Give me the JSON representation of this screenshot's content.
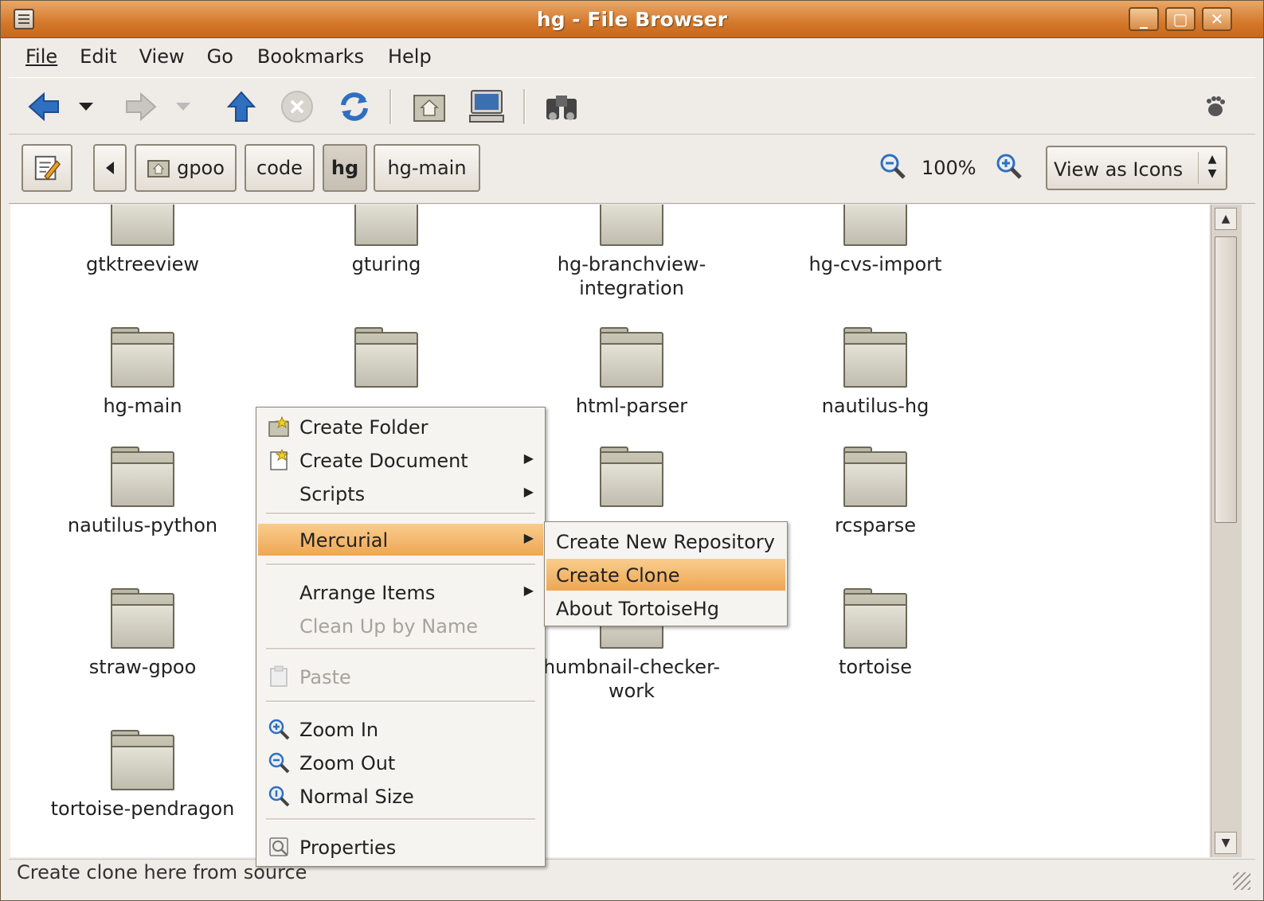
{
  "window": {
    "title": "hg - File Browser"
  },
  "menubar": [
    "File",
    "Edit",
    "View",
    "Go",
    "Bookmarks",
    "Help"
  ],
  "path": {
    "buttons": [
      "gpoo",
      "code",
      "hg",
      "hg-main"
    ],
    "active": "hg"
  },
  "zoom": {
    "level": "100%"
  },
  "view_combo": {
    "selected": "View as Icons"
  },
  "folders": [
    "gtktreeview",
    "gturing",
    "hg-branchview-integration",
    "hg-cvs-import",
    "hg-main",
    "html-parser",
    "nautilus-hg",
    "nautilus-python",
    "rcsparse",
    "straw-gpoo",
    "humbnail-checker-work",
    "tortoise",
    "tortoise-pendragon"
  ],
  "context_menu": {
    "items": [
      {
        "label": "Create Folder",
        "icon": "new-folder-icon"
      },
      {
        "label": "Create Document",
        "icon": "new-document-icon"
      },
      {
        "label": "Scripts"
      },
      {
        "label": "Mercurial"
      },
      {
        "label": "Arrange Items"
      },
      {
        "label": "Clean Up by Name"
      },
      {
        "label": "Paste",
        "icon": "paste-icon"
      },
      {
        "label": "Zoom In",
        "icon": "zoom-in-icon"
      },
      {
        "label": "Zoom Out",
        "icon": "zoom-out-icon"
      },
      {
        "label": "Normal Size",
        "icon": "normal-size-icon"
      },
      {
        "label": "Properties",
        "icon": "properties-icon"
      }
    ],
    "highlighted": "Mercurial"
  },
  "mercurial_submenu": {
    "items": [
      "Create New Repository",
      "Create Clone",
      "About TortoiseHg"
    ],
    "highlighted": "Create Clone"
  },
  "statusbar": {
    "text": "Create clone here from source"
  },
  "colors": {
    "titlebar": "#d4782b",
    "highlight": "#f2b46a"
  }
}
